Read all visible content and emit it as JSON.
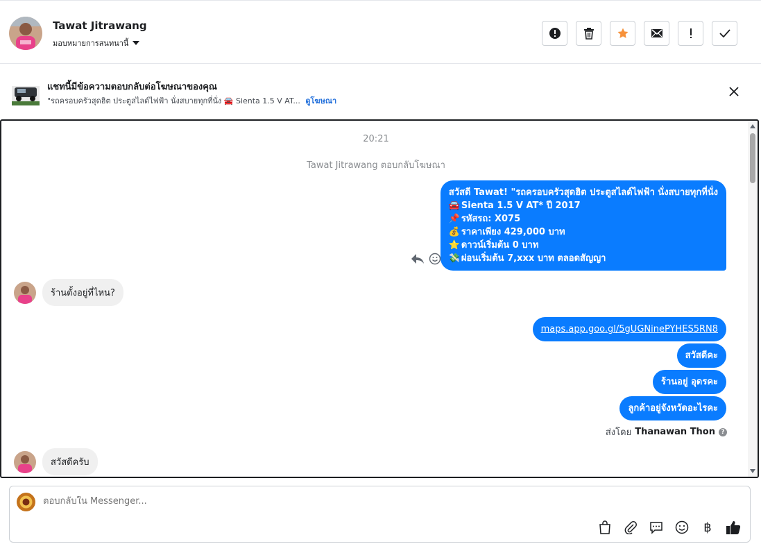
{
  "header": {
    "name": "Tawat Jitrawang",
    "assign_label": "มอบหมายการสนทนานี้"
  },
  "actions": [
    {
      "icon": "alert-circle-icon"
    },
    {
      "icon": "trash-icon"
    },
    {
      "icon": "star-icon",
      "color": "#f7923b"
    },
    {
      "icon": "envelope-icon"
    },
    {
      "icon": "exclamation-icon"
    },
    {
      "icon": "checkmark-icon"
    }
  ],
  "ad_banner": {
    "title": "แชทนี้มีข้อความตอบกลับต่อโฆษณาของคุณ",
    "subtitle": "\"รถครอบครัวสุดฮิต ประตูสไลด์ไฟฟ้า นั่งสบายทุกที่นั่ง 🚘 Sienta 1.5 V AT...",
    "link": "ดูโฆษณา"
  },
  "chat": {
    "timestamp": "20:21",
    "replied_notice": "Tawat Jitrawang ตอบกลับโฆษณา",
    "ad_message": {
      "lines": [
        {
          "icon": "",
          "text": "สวัสดี Tawat! \"รถครอบครัวสุดฮิต ประตูสไลด์ไฟฟ้า นั่งสบายทุกที่นั่ง"
        },
        {
          "icon": "🚘",
          "text": "Sienta 1.5 V AT* ปี 2017"
        },
        {
          "icon": "📌",
          "text": "รหัสรถ: X075"
        },
        {
          "icon": "💰",
          "text": "ราคาเพียง 429,000 บาท"
        },
        {
          "icon": "⭐",
          "text": "ดาวน์เริ่มต้น 0 บาท"
        },
        {
          "icon": "💸",
          "text": "ผ่อนเริ่มต้น 7,xxx บาท ตลอดสัญญา"
        }
      ]
    },
    "incoming_1": "ร้านตั้งอยู่ที่ไหน?",
    "outgoing": [
      "maps.app.goo.gl/5gUGNinePYHES5RN8",
      "สวัสดีคะ",
      "ร้านอยู่ อุดรคะ",
      "ลูกค้าอยู่จังหวัดอะไรคะ"
    ],
    "sent_by_label": "ส่งโดย",
    "sent_by_name": "Thanawan Thon",
    "incoming_2": "สวัสดีครับ",
    "colors": {
      "outgoing": "#0a7cff",
      "incoming": "#f0f0f0"
    }
  },
  "composer": {
    "placeholder": "ตอบกลับใน Messenger...",
    "tools": [
      "shopping-bag-icon",
      "paperclip-icon",
      "quick-reply-icon",
      "emoji-icon",
      "baht-icon",
      "thumbs-up-icon"
    ],
    "baht_glyph": "฿"
  }
}
